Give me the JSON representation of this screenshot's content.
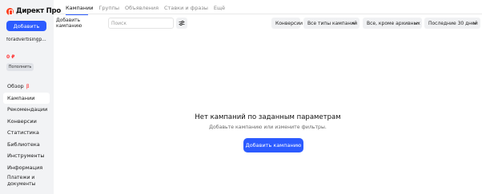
{
  "app": {
    "title": "Директ Про"
  },
  "sidebar": {
    "add_button": "Добавить",
    "account": "foradvertisingp...",
    "balance": "0 ₽",
    "topup": "Пополнить",
    "items": [
      {
        "label": "Обзор",
        "badge": "β"
      },
      {
        "label": "Кампании"
      },
      {
        "label": "Рекомендации"
      },
      {
        "label": "Конверсии"
      },
      {
        "label": "Статистика"
      },
      {
        "label": "Библиотека"
      },
      {
        "label": "Инструменты"
      },
      {
        "label": "Информация"
      },
      {
        "label": "Платежи и документы"
      }
    ]
  },
  "tabs": [
    "Кампании",
    "Группы",
    "Объявления",
    "Ставки и фразы",
    "Ещё"
  ],
  "toolbar": {
    "add_campaign": "Добавить кампанию",
    "search_placeholder": "Поиск",
    "conversions": "Конверсии",
    "campaign_types": "Все типы кампаний",
    "status": "Все, кроме архивных",
    "period": "Последние 30 дней"
  },
  "empty_state": {
    "title": "Нет кампаний по заданным параметрам",
    "subtitle": "Добавьте кампанию или измените фильтры.",
    "button": "Добавить кампанию"
  },
  "colors": {
    "accent": "#2c5bff",
    "brand_red": "#fc3f1d"
  }
}
